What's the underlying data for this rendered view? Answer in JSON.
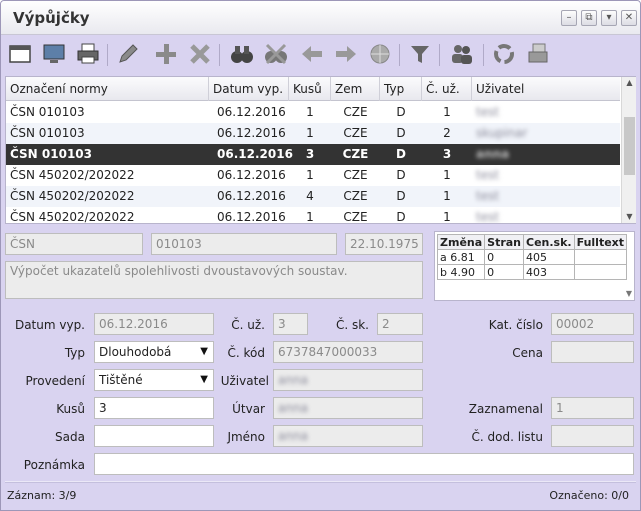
{
  "window": {
    "title": "Výpůjčky"
  },
  "toolbar": {
    "icons": [
      "window-icon",
      "monitor-icon",
      "printer-icon",
      "pencil-icon",
      "plus-icon",
      "cross-icon",
      "binoculars-icon",
      "binoculars-cross-icon",
      "arrow-left-icon",
      "arrow-right-icon",
      "globe-icon",
      "funnel-icon",
      "people-icon",
      "recycle-icon",
      "printer-stack-icon"
    ]
  },
  "grid": {
    "columns": [
      "Označení normy",
      "Datum vyp.",
      "Kusů",
      "Zem",
      "Typ",
      "Č. už.",
      "Uživatel"
    ],
    "rows": [
      {
        "norma": "ČSN 010103",
        "datum": "06.12.2016",
        "kusu": "1",
        "zem": "CZE",
        "typ": "D",
        "cuz": "1",
        "uzivatel": "test"
      },
      {
        "norma": "ČSN 010103",
        "datum": "06.12.2016",
        "kusu": "1",
        "zem": "CZE",
        "typ": "D",
        "cuz": "2",
        "uzivatel": "skupinar"
      },
      {
        "norma": "ČSN 010103",
        "datum": "06.12.2016",
        "kusu": "3",
        "zem": "CZE",
        "typ": "D",
        "cuz": "3",
        "uzivatel": "anna"
      },
      {
        "norma": "ČSN 450202/202022",
        "datum": "06.12.2016",
        "kusu": "1",
        "zem": "CZE",
        "typ": "D",
        "cuz": "1",
        "uzivatel": "test"
      },
      {
        "norma": "ČSN 450202/202022",
        "datum": "06.12.2016",
        "kusu": "4",
        "zem": "CZE",
        "typ": "D",
        "cuz": "1",
        "uzivatel": "test"
      },
      {
        "norma": "ČSN 450202/202022",
        "datum": "06.12.2016",
        "kusu": "1",
        "zem": "CZE",
        "typ": "D",
        "cuz": "1",
        "uzivatel": "test"
      }
    ]
  },
  "norm": {
    "prefix": "ČSN",
    "number": "010103",
    "date": "22.10.1975",
    "description": "Výpočet ukazatelů spolehlivosti dvoustavových soustav."
  },
  "changes": {
    "columns": [
      "Změna",
      "Stran",
      "Cen.sk.",
      "Fulltext"
    ],
    "rows": [
      {
        "zmena": "a 6.81",
        "stran": "0",
        "cen": "405",
        "full": ""
      },
      {
        "zmena": "b 4.90",
        "stran": "0",
        "cen": "403",
        "full": ""
      }
    ]
  },
  "form": {
    "datum_vyp_label": "Datum vyp.",
    "datum_vyp": "06.12.2016",
    "c_uz_label": "Č. už.",
    "c_uz": "3",
    "c_sk_label": "Č. sk.",
    "c_sk": "2",
    "kat_cislo_label": "Kat. číslo",
    "kat_cislo": "00002",
    "typ_label": "Typ",
    "typ": "Dlouhodobá",
    "c_kod_label": "Č. kód",
    "c_kod": "6737847000033",
    "cena_label": "Cena",
    "cena": "",
    "provedeni_label": "Provedení",
    "provedeni": "Tištěné",
    "uzivatel_label": "Uživatel",
    "uzivatel": "anna",
    "kusu_label": "Kusů",
    "kusu": "3",
    "utvar_label": "Útvar",
    "utvar": "anna",
    "zaznamenal_label": "Zaznamenal",
    "zaznamenal": "1",
    "sada_label": "Sada",
    "sada": "",
    "jmeno_label": "Jméno",
    "jmeno": "anna",
    "c_dod_listu_label": "Č. dod. listu",
    "c_dod_listu": "",
    "poznamka_label": "Poznámka",
    "poznamka": ""
  },
  "status": {
    "zaznam": "Záznam:  3/9",
    "oznaceno": "Označeno: 0/0"
  }
}
